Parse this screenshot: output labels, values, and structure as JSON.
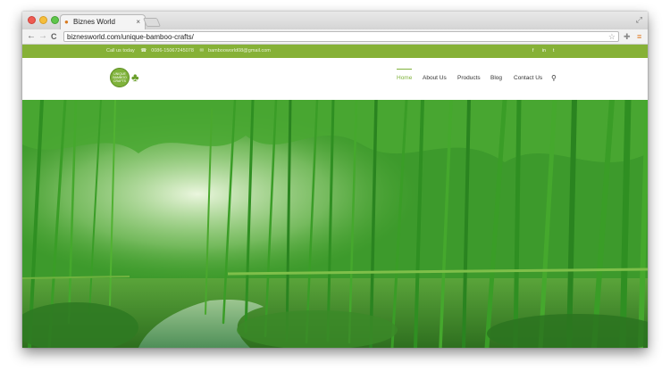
{
  "browser": {
    "tab_title": "Biznes World",
    "tab_close": "×",
    "url": "biznesworld.com/unique-bamboo-crafts/",
    "back_glyph": "←",
    "forward_glyph": "→",
    "reload_glyph": "C",
    "star_glyph": "☆",
    "expand_glyph": "⤢",
    "icons": [
      "bookmark-star-icon",
      "extension-icon",
      "menu-icon"
    ]
  },
  "topbar": {
    "call_text": "Call us today",
    "phone": "0086-15067245078",
    "email": "bambooworld08@gmail.com",
    "social": [
      "f",
      "in",
      "t"
    ],
    "background": "#86b137"
  },
  "logo": {
    "text": "UNIQUE BAMBOO CRAFTS"
  },
  "nav": {
    "items": [
      {
        "label": "Home",
        "active": true
      },
      {
        "label": "About Us",
        "active": false
      },
      {
        "label": "Products",
        "active": false
      },
      {
        "label": "Blog",
        "active": false
      },
      {
        "label": "Contact Us",
        "active": false
      }
    ],
    "search_icon": "⚲",
    "accent": "#7fb23b"
  },
  "hero": {
    "image": "bamboo-forest-path-photo"
  }
}
